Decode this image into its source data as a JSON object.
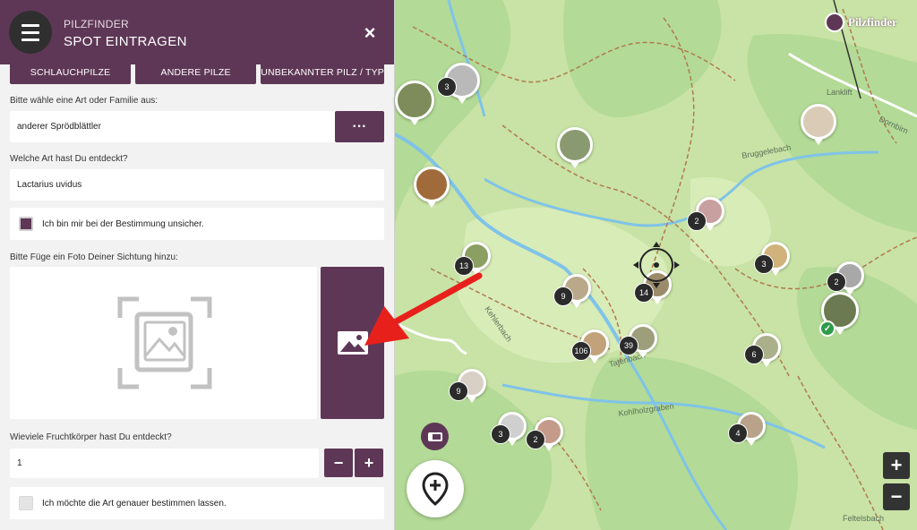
{
  "header": {
    "app_name": "PILZFINDER",
    "title": "SPOT EINTRAGEN",
    "close_label": "×",
    "menu_icon": "hamburger-menu-icon"
  },
  "category_tabs": [
    {
      "label": "SCHLAUCHPILZE"
    },
    {
      "label": "ANDERE PILZE"
    },
    {
      "label": "UNBEKANNTER PILZ / TYP"
    }
  ],
  "species": {
    "label": "Bitte wähle eine Art oder Familie aus:",
    "value": "anderer Sprödblättler",
    "more_label": "···"
  },
  "discovered": {
    "label": "Welche Art hast Du entdeckt?",
    "value": "Lactarius uvidus"
  },
  "unsure": {
    "label": "Ich bin mir bei der Bestimmung unsicher.",
    "checked": true
  },
  "photo": {
    "label": "Bitte Füge ein Foto Deiner Sichtung hinzu:",
    "placeholder_icon": "image-placeholder-icon",
    "button_icon": "image-upload-icon"
  },
  "count": {
    "label": "Wieviele Fruchtkörper hast Du entdeckt?",
    "value": "1",
    "minus_label": "−",
    "plus_label": "+"
  },
  "identify": {
    "label": "Ich möchte die Art genauer bestimmen lassen.",
    "checked": false
  },
  "map": {
    "logo_text": "Pilzfinder",
    "place_labels": [
      "Lanklift",
      "Bruggelebach",
      "Dornbirn",
      "Kehlerbach",
      "Tatenbach",
      "Feltelsbach",
      "Kohlholzgraben"
    ],
    "clusters": [
      "3",
      "2",
      "13",
      "9",
      "14",
      "3",
      "2",
      "106",
      "39",
      "6",
      "9",
      "3",
      "2",
      "4"
    ],
    "zoom_in": "+",
    "zoom_out": "−",
    "colors": {
      "land": "#c8e3a5",
      "forest": "#a9d68a",
      "water": "#7fc3e8",
      "path": "#b07a4f"
    }
  },
  "colors": {
    "accent": "#5e3756",
    "panel_bg": "#f2f2f2"
  }
}
